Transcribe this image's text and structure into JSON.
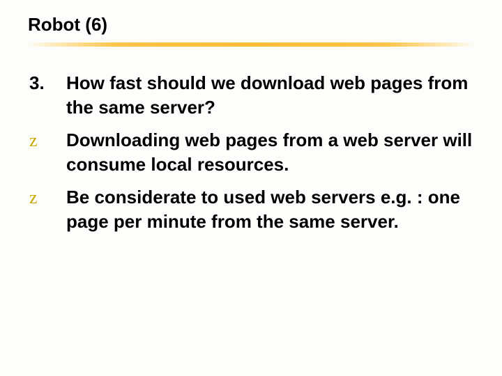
{
  "title": "Robot (6)",
  "items": [
    {
      "marker": "3.",
      "markerClass": "num",
      "text": " How fast should we download web pages from the same server?"
    },
    {
      "marker": "z",
      "markerClass": "z",
      "text": "Downloading web pages from a web server will consume local resources."
    },
    {
      "marker": "z",
      "markerClass": "z",
      "text": "Be considerate to used web servers  e.g. : one page per minute from the same server."
    }
  ]
}
